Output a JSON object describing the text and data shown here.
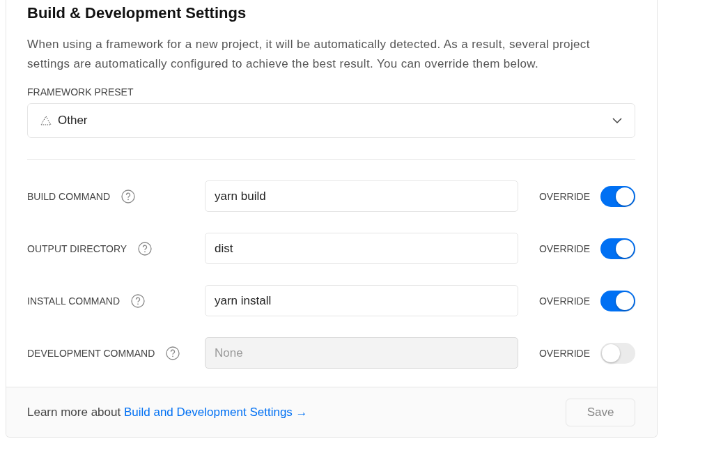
{
  "title": "Build & Development Settings",
  "description": "When using a framework for a new project, it will be automatically detected. As a result, several project settings are automatically configured to achieve the best result. You can override them below.",
  "framework": {
    "label": "FRAMEWORK PRESET",
    "value": "Other"
  },
  "settings": [
    {
      "label": "BUILD COMMAND",
      "value": "yarn build",
      "disabled": false,
      "override_label": "OVERRIDE",
      "override": true
    },
    {
      "label": "OUTPUT DIRECTORY",
      "value": "dist",
      "disabled": false,
      "override_label": "OVERRIDE",
      "override": true
    },
    {
      "label": "INSTALL COMMAND",
      "value": "yarn install",
      "disabled": false,
      "override_label": "OVERRIDE",
      "override": true
    },
    {
      "label": "DEVELOPMENT COMMAND",
      "placeholder": "None",
      "disabled": true,
      "override_label": "OVERRIDE",
      "override": false
    }
  ],
  "footer": {
    "text": "Learn more about",
    "link": "Build and Development Settings →",
    "save": {
      "label": "Save",
      "disabled": true
    }
  }
}
